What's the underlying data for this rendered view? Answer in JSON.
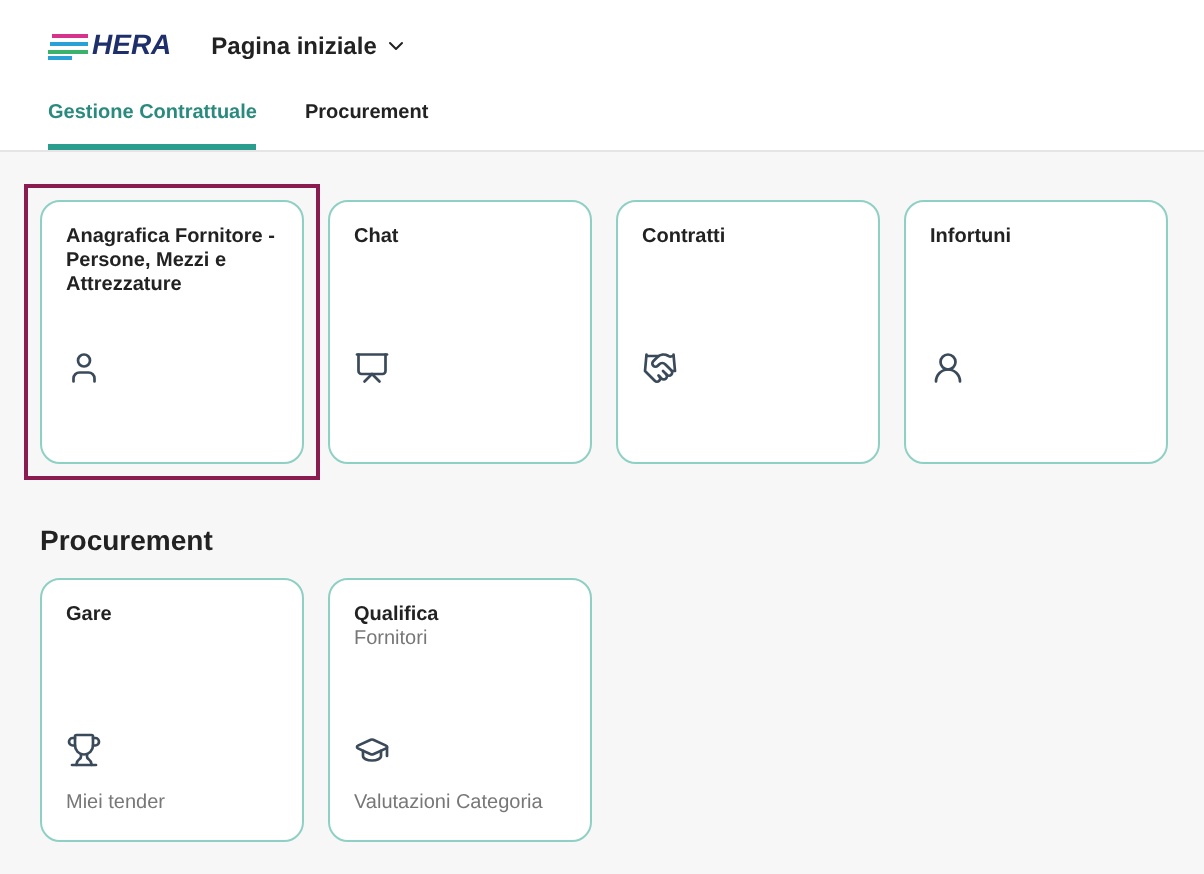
{
  "header": {
    "logo": "HERA",
    "title": "Pagina iniziale"
  },
  "tabs": [
    {
      "label": "Gestione Contrattuale",
      "selected": true
    },
    {
      "label": "Procurement",
      "selected": false
    }
  ],
  "sections": [
    {
      "tiles": [
        {
          "title": "Anagrafica Fornitore - Persone, Mezzi e Attrezzature",
          "selected": true
        },
        {
          "title": "Chat",
          "selected": false
        },
        {
          "title": "Contratti",
          "selected": false
        },
        {
          "title": "Infortuni",
          "selected": false
        }
      ]
    },
    {
      "heading": "Procurement",
      "tiles": [
        {
          "title": "Gare",
          "footer": "Miei tender",
          "selected": false
        },
        {
          "title": "Qualifica",
          "subtitle": "Fornitori",
          "footer": "Valutazioni Categoria",
          "selected": false
        }
      ]
    }
  ]
}
